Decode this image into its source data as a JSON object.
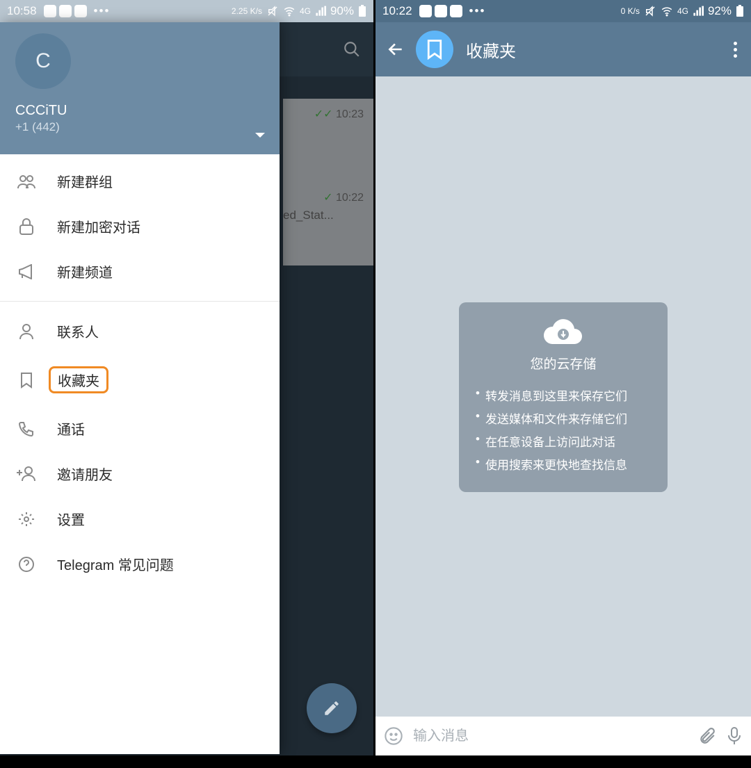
{
  "left": {
    "status": {
      "time": "10:58",
      "speed": "2.25 K/s",
      "net": "4G",
      "battery": "90%"
    },
    "account": {
      "initial": "C",
      "name": "CCCiTU",
      "phone": "+1 (442)"
    },
    "drawer": {
      "items": [
        {
          "label": "新建群组"
        },
        {
          "label": "新建加密对话"
        },
        {
          "label": "新建频道"
        },
        {
          "label": "联系人"
        },
        {
          "label": "收藏夹",
          "highlight": true
        },
        {
          "label": "通话"
        },
        {
          "label": "邀请朋友"
        },
        {
          "label": "设置"
        },
        {
          "label": "Telegram 常见问题"
        }
      ]
    },
    "bgrows": [
      {
        "time": "10:23"
      },
      {
        "time": "10:22",
        "line2": "ed_Stat..."
      }
    ]
  },
  "right": {
    "status": {
      "time": "10:22",
      "speed": "0 K/s",
      "net": "4G",
      "battery": "92%"
    },
    "appbar": {
      "title": "收藏夹"
    },
    "cloud": {
      "title": "您的云存储",
      "lines": [
        "转发消息到这里来保存它们",
        "发送媒体和文件来存储它们",
        "在任意设备上访问此对话",
        "使用搜索来更快地查找信息"
      ]
    },
    "composer": {
      "placeholder": "输入消息"
    }
  }
}
